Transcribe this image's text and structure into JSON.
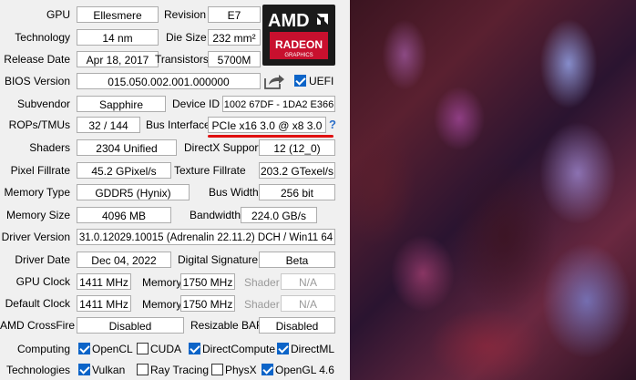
{
  "gpu": {
    "gpu_label": "GPU",
    "gpu": "Ellesmere",
    "revision_label": "Revision",
    "revision": "E7",
    "technology_label": "Technology",
    "technology": "14 nm",
    "die_size_label": "Die Size",
    "die_size": "232 mm²",
    "release_date_label": "Release Date",
    "release_date": "Apr 18, 2017",
    "transistors_label": "Transistors",
    "transistors": "5700M",
    "bios_label": "BIOS Version",
    "bios": "015.050.002.001.000000",
    "uefi_label": "UEFI",
    "uefi_checked": true,
    "subvendor_label": "Subvendor",
    "subvendor": "Sapphire",
    "device_id_label": "Device ID",
    "device_id": "1002 67DF - 1DA2 E366",
    "rops_label": "ROPs/TMUs",
    "rops": "32 / 144",
    "bus_label": "Bus Interface",
    "bus": "PCIe x16 3.0 @ x8 3.0",
    "bus_help": "?",
    "shaders_label": "Shaders",
    "shaders": "2304 Unified",
    "directx_label": "DirectX Support",
    "directx": "12 (12_0)",
    "pixel_label": "Pixel Fillrate",
    "pixel": "45.2 GPixel/s",
    "texture_label": "Texture Fillrate",
    "texture": "203.2 GTexel/s",
    "memtype_label": "Memory Type",
    "memtype": "GDDR5 (Hynix)",
    "buswidth_label": "Bus Width",
    "buswidth": "256 bit",
    "memsize_label": "Memory Size",
    "memsize": "4096 MB",
    "bandwidth_label": "Bandwidth",
    "bandwidth": "224.0 GB/s",
    "driver_label": "Driver Version",
    "driver": "31.0.12029.10015 (Adrenalin 22.11.2) DCH / Win11 64",
    "driverdate_label": "Driver Date",
    "driverdate": "Dec 04, 2022",
    "digsig_label": "Digital Signature",
    "digsig": "Beta",
    "gpuclock_label": "GPU Clock",
    "gpuclock": "1411 MHz",
    "memory_label": "Memory",
    "memclock": "1750 MHz",
    "shader_label": "Shader",
    "shader": "N/A",
    "defclock_label": "Default Clock",
    "defclock": "1411 MHz",
    "defmemclock": "1750 MHz",
    "defshader": "N/A",
    "crossfire_label": "AMD CrossFire",
    "crossfire": "Disabled",
    "rebar_label": "Resizable BAR",
    "rebar": "Disabled",
    "computing_label": "Computing",
    "technologies_label": "Technologies"
  },
  "computing": [
    {
      "label": "OpenCL",
      "checked": true
    },
    {
      "label": "CUDA",
      "checked": false
    },
    {
      "label": "DirectCompute",
      "checked": true
    },
    {
      "label": "DirectML",
      "checked": true
    }
  ],
  "technologies": [
    {
      "label": "Vulkan",
      "checked": true
    },
    {
      "label": "Ray Tracing",
      "checked": false
    },
    {
      "label": "PhysX",
      "checked": false
    },
    {
      "label": "OpenGL 4.6",
      "checked": true
    }
  ],
  "logo": {
    "brand": "AMD",
    "product": "RADEON",
    "sub": "GRAPHICS"
  },
  "icons": {
    "share": "share-icon",
    "help": "help-icon"
  },
  "colors": {
    "accent": "#0c64c8",
    "underline": "#e01010",
    "logo_red": "#c8102e"
  }
}
